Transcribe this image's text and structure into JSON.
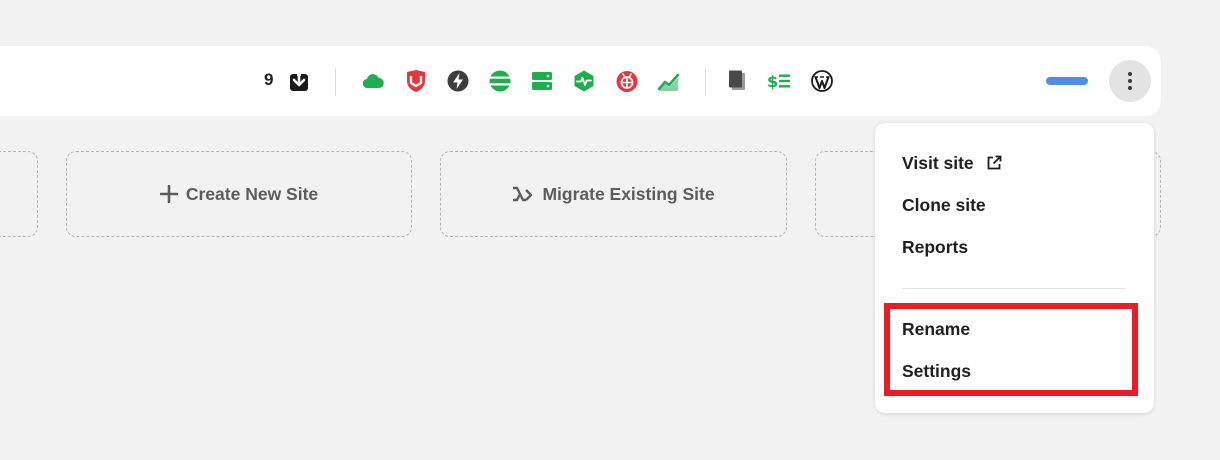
{
  "toolbar": {
    "count": "9",
    "icons": {
      "download": "download-icon",
      "cloud": "cloud-icon",
      "shield": "mcafee-shield-icon",
      "bolt": "lightning-icon",
      "globe": "globe-icon",
      "server": "server-icon",
      "monitor": "uptime-monitor-icon",
      "bug": "bug-icon",
      "analytics": "analytics-chart-icon",
      "copy": "files-icon",
      "billing": "dollar-list-icon",
      "wordpress": "wordpress-icon",
      "more": "more-vertical-icon"
    },
    "colors": {
      "green": "#1fad4e",
      "red": "#e8343c",
      "pill": "#4f8ee8"
    }
  },
  "tiles": [
    {
      "label": "Create New Site",
      "icon": "plus-icon"
    },
    {
      "label": "Migrate Existing Site",
      "icon": "migrate-icon"
    }
  ],
  "menu": {
    "visit_site": "Visit site",
    "visit_icon": "external-link-icon",
    "clone_site": "Clone site",
    "reports": "Reports",
    "rename": "Rename",
    "settings": "Settings",
    "highlight_color": "#ec1c24"
  }
}
